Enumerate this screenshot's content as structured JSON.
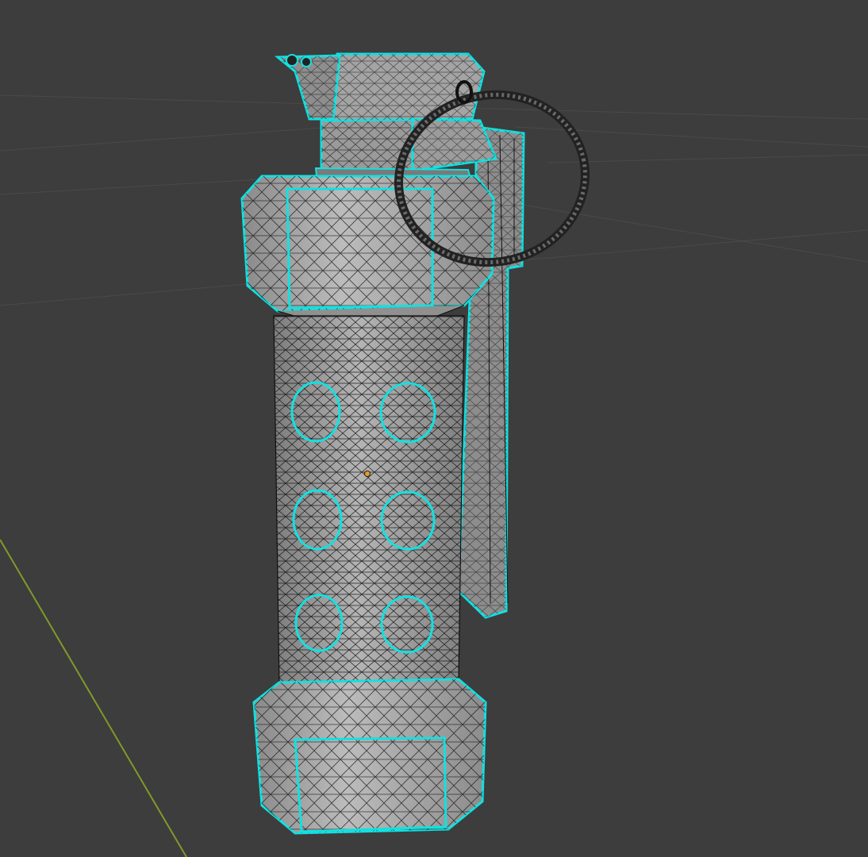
{
  "viewport": {
    "background": "#3d3d3d",
    "grid_color": "#474747",
    "axis_y_color": "#7f9a2a"
  },
  "model": {
    "fill_light": "#a9a9a9",
    "fill_mid": "#8f8f8f",
    "fill_dark": "#6f6f6f",
    "wire_color": "#111111",
    "seam_color": "#14e0e0",
    "origin_color": "#e89a2a",
    "hole_count": 6
  }
}
